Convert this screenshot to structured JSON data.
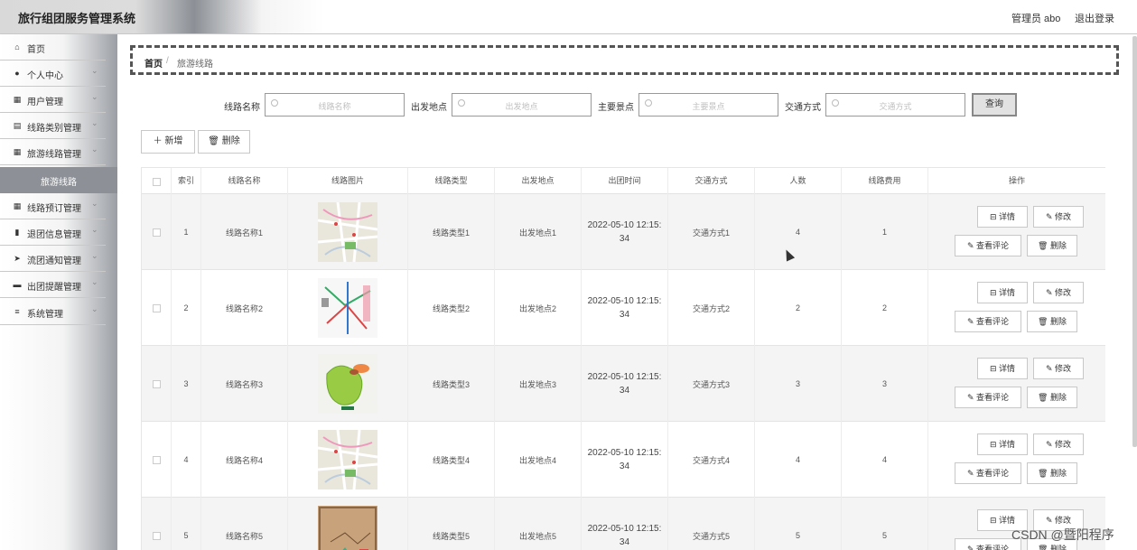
{
  "app": {
    "title": "旅行组团服务管理系统"
  },
  "header": {
    "user": "管理员 abo",
    "logout": "退出登录"
  },
  "sidebar": {
    "items": [
      {
        "label": "首页",
        "icon": "home-icon",
        "glyph": "⌂",
        "chevron": false
      },
      {
        "label": "个人中心",
        "icon": "user-icon",
        "glyph": "●",
        "chevron": true
      },
      {
        "label": "用户管理",
        "icon": "grid-icon",
        "glyph": "▦",
        "chevron": true
      },
      {
        "label": "线路类别管理",
        "icon": "clipboard-icon",
        "glyph": "▤",
        "chevron": true
      },
      {
        "label": "旅游线路管理",
        "icon": "grid-icon",
        "glyph": "▦",
        "chevron": true
      },
      {
        "label": "线路预订管理",
        "icon": "grid-icon",
        "glyph": "▦",
        "chevron": true
      },
      {
        "label": "退团信息管理",
        "icon": "bar-chart-icon",
        "glyph": "▮",
        "chevron": true
      },
      {
        "label": "流团通知管理",
        "icon": "send-icon",
        "glyph": "➤",
        "chevron": true
      },
      {
        "label": "出团提醒管理",
        "icon": "card-icon",
        "glyph": "▬",
        "chevron": true
      },
      {
        "label": "系统管理",
        "icon": "list-icon",
        "glyph": "≡",
        "chevron": true
      }
    ],
    "active_sub": "旅游线路"
  },
  "breadcrumb": {
    "home": "首页",
    "separator": "/",
    "current": "旅游线路"
  },
  "search": {
    "fields": [
      {
        "label": "线路名称",
        "placeholder": "线路名称"
      },
      {
        "label": "出发地点",
        "placeholder": "出发地点"
      },
      {
        "label": "主要景点",
        "placeholder": "主要景点"
      },
      {
        "label": "交通方式",
        "placeholder": "交通方式"
      }
    ],
    "query_button": "查询"
  },
  "toolbar": {
    "add": "＋ 新增",
    "delete": "🗑 删除"
  },
  "table": {
    "headers": [
      "",
      "索引",
      "线路名称",
      "线路图片",
      "线路类型",
      "出发地点",
      "出团时间",
      "交通方式",
      "人数",
      "线路费用",
      "操作"
    ],
    "rows": [
      {
        "index": "1",
        "name": "线路名称1",
        "type": "线路类型1",
        "depart": "出发地点1",
        "time": [
          "2022-05-10 12:15:",
          "34"
        ],
        "transport": "交通方式1",
        "people": "4",
        "cost": "1",
        "img": "map-a"
      },
      {
        "index": "2",
        "name": "线路名称2",
        "type": "线路类型2",
        "depart": "出发地点2",
        "time": [
          "2022-05-10 12:15:",
          "34"
        ],
        "transport": "交通方式2",
        "people": "2",
        "cost": "2",
        "img": "metro"
      },
      {
        "index": "3",
        "name": "线路名称3",
        "type": "线路类型3",
        "depart": "出发地点3",
        "time": [
          "2022-05-10 12:15:",
          "34"
        ],
        "transport": "交通方式3",
        "people": "3",
        "cost": "3",
        "img": "green"
      },
      {
        "index": "4",
        "name": "线路名称4",
        "type": "线路类型4",
        "depart": "出发地点4",
        "time": [
          "2022-05-10 12:15:",
          "34"
        ],
        "transport": "交通方式4",
        "people": "4",
        "cost": "4",
        "img": "map-a"
      },
      {
        "index": "5",
        "name": "线路名称5",
        "type": "线路类型5",
        "depart": "出发地点5",
        "time": [
          "2022-05-10 12:15:",
          "34"
        ],
        "transport": "交通方式5",
        "people": "5",
        "cost": "5",
        "img": "old"
      }
    ],
    "actions": {
      "detail": "详情",
      "edit": "修改",
      "comments": "查看评论",
      "delete": "删除"
    }
  },
  "watermark": "CSDN @暨阳程序"
}
